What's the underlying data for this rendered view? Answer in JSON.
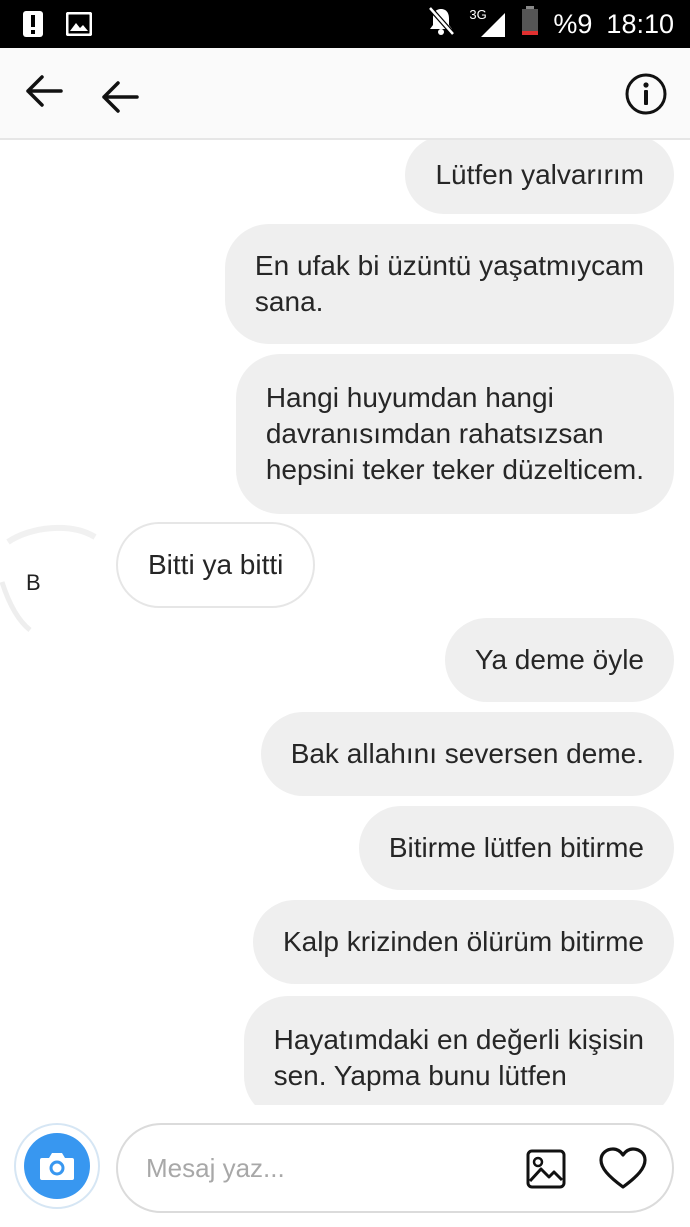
{
  "status_bar": {
    "network": "3G",
    "battery_percent": "%9",
    "time": "18:10",
    "icons": [
      "alert-icon",
      "image-notification-icon",
      "mute-bell-icon",
      "signal-icon",
      "battery-icon"
    ]
  },
  "header": {
    "icons": [
      "back-arrow-icon",
      "back-arrow-icon",
      "info-icon"
    ]
  },
  "chat": {
    "contact_initial": "B",
    "messages": [
      {
        "sender": "me",
        "text": "Lütfen yalvarırım"
      },
      {
        "sender": "me",
        "text": "En ufak bi üzüntü yaşatmıycam\nsana."
      },
      {
        "sender": "me",
        "text": "Hangi huyumdan hangi\ndavranısımdan rahatsızsan\nhepsini teker teker düzelticem."
      },
      {
        "sender": "them",
        "text": "Bitti ya bitti"
      },
      {
        "sender": "me",
        "text": "Ya deme öyle"
      },
      {
        "sender": "me",
        "text": "Bak allahını seversen deme."
      },
      {
        "sender": "me",
        "text": "Bitirme lütfen bitirme"
      },
      {
        "sender": "me",
        "text": "Kalp krizinden ölürüm bitirme"
      },
      {
        "sender": "me",
        "text": "Hayatımdaki en değerli kişisin\nsen. Yapma bunu lütfen"
      }
    ]
  },
  "composer": {
    "placeholder": "Mesaj yaz...",
    "value": "",
    "icons": [
      "camera-icon",
      "gallery-icon",
      "heart-icon"
    ]
  },
  "colors": {
    "accent": "#3897f0",
    "outgoing_bubble": "#efefef",
    "incoming_border": "#e6e6e6",
    "status_bar": "#000000"
  }
}
